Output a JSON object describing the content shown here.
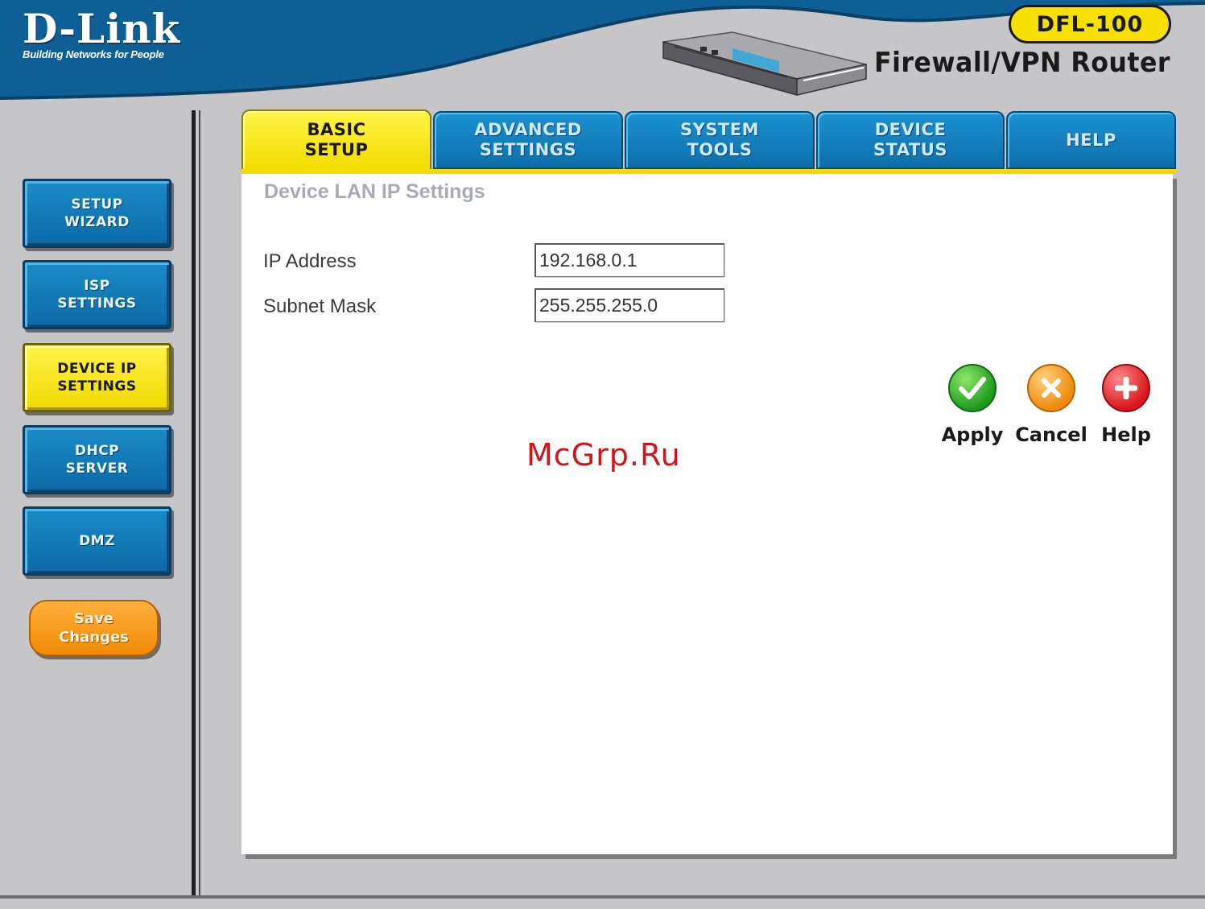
{
  "header": {
    "logo_text": "D-Link",
    "logo_tagline": "Building Networks for People",
    "model": "DFL-100",
    "product_title": "Firewall/VPN Router"
  },
  "tabs": [
    {
      "label": "BASIC\nSETUP",
      "active": true
    },
    {
      "label": "ADVANCED\nSETTINGS",
      "active": false
    },
    {
      "label": "SYSTEM\nTOOLS",
      "active": false
    },
    {
      "label": "DEVICE\nSTATUS",
      "active": false
    },
    {
      "label": "HELP",
      "active": false
    }
  ],
  "sidebar": {
    "items": [
      {
        "label": "SETUP\nWIZARD",
        "active": false
      },
      {
        "label": "ISP\nSETTINGS",
        "active": false
      },
      {
        "label": "DEVICE IP\nSETTINGS",
        "active": true
      },
      {
        "label": "DHCP\nSERVER",
        "active": false
      },
      {
        "label": "DMZ",
        "active": false
      }
    ],
    "save_label": "Save\nChanges"
  },
  "main": {
    "section_title": "Device LAN IP Settings",
    "fields": [
      {
        "label": "IP Address",
        "value": "192.168.0.1"
      },
      {
        "label": "Subnet Mask",
        "value": "255.255.255.0"
      }
    ],
    "actions": {
      "apply": "Apply",
      "cancel": "Cancel",
      "help": "Help"
    }
  },
  "watermark": "McGrp.Ru",
  "colors": {
    "page_bg": "#c6c6c9",
    "header_blue": "#0e5f95",
    "tab_blue": "#1184c4",
    "active_yellow": "#f5e100",
    "save_orange": "#f59416",
    "apply_green": "#1d9a1d",
    "cancel_orange": "#ee8a0f",
    "help_red": "#d8161c",
    "watermark_red": "#d2141a"
  },
  "icons": {
    "apply": "checkmark-icon",
    "cancel": "x-icon",
    "help": "plus-icon"
  }
}
